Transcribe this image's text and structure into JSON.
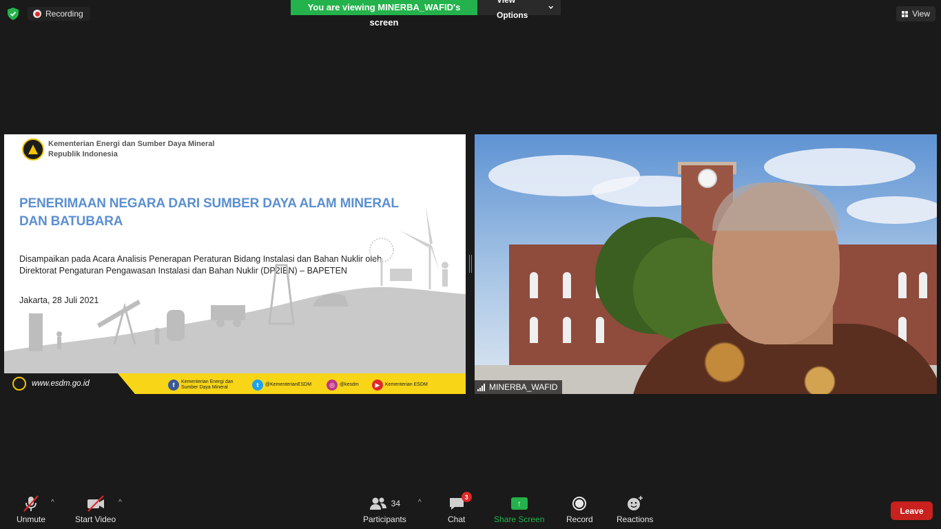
{
  "top": {
    "recording_label": "Recording",
    "viewing_text": "You are viewing MINERBA_WAFID's screen",
    "view_options_label": "View Options",
    "view_label": "View"
  },
  "slide": {
    "ministry_line1": "Kementerian Energi dan Sumber Daya Mineral",
    "ministry_line2": "Republik Indonesia",
    "title": "PENERIMAAN NEGARA DARI SUMBER DAYA ALAM MINERAL DAN BATUBARA",
    "subtitle_line1": "Disampaikan pada Acara Analisis Penerapan Peraturan Bidang Instalasi dan Bahan Nuklir oleh",
    "subtitle_line2": "Direktorat Pengaturan Pengawasan Instalasi dan Bahan Nuklir (DP2IBN) – BAPETEN",
    "date": "Jakarta, 28 Juli 2021",
    "footer_url": "www.esdm.go.id",
    "social_facebook_line1": "Kementerian Energi dan",
    "social_facebook_line2": "Sumber Daya Mineral",
    "social_twitter": "@KementerianESDM",
    "social_instagram": "@kesdm",
    "social_youtube": "Kementerian ESDM"
  },
  "video": {
    "participant_name": "MINERBA_WAFID"
  },
  "toolbar": {
    "unmute_label": "Unmute",
    "start_video_label": "Start Video",
    "participants_label": "Participants",
    "participants_count": "34",
    "chat_label": "Chat",
    "chat_badge": "3",
    "share_screen_label": "Share Screen",
    "record_label": "Record",
    "reactions_label": "Reactions",
    "leave_label": "Leave"
  },
  "colors": {
    "green": "#23b24b",
    "leave_red": "#c8211e",
    "slide_title_blue": "#5b8fd1",
    "esdm_yellow": "#f8d617"
  }
}
